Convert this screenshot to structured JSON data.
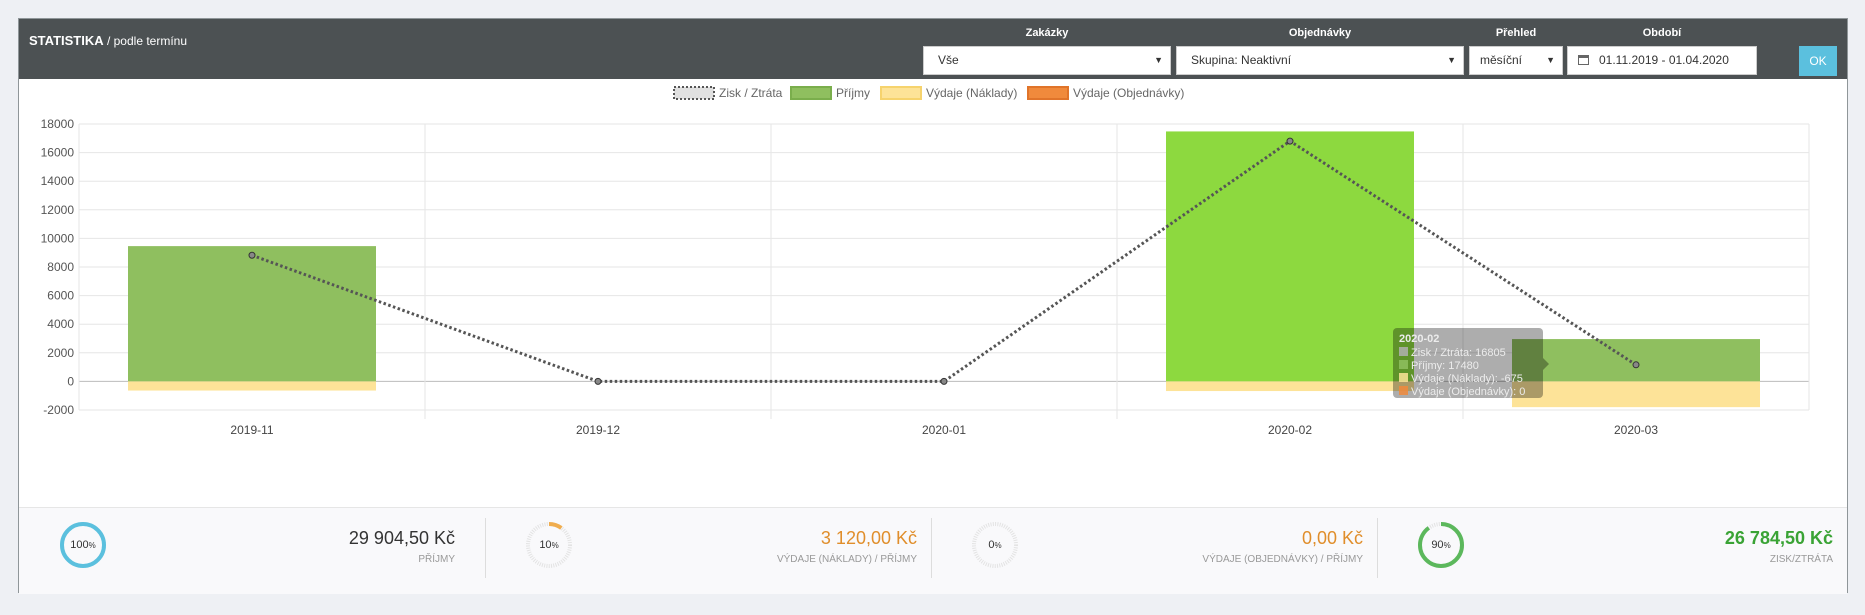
{
  "header": {
    "title_bold": "STATISTIKA",
    "title_rest": " / podle termínu"
  },
  "filters": {
    "zakazky": {
      "label": "Zakázky",
      "value": "Vše"
    },
    "objednavky": {
      "label": "Objednávky",
      "value": "Skupina: Neaktivní"
    },
    "prehled": {
      "label": "Přehled",
      "value": "měsíční"
    },
    "obdobi": {
      "label": "Období",
      "value": "01.11.2019 - 01.04.2020"
    },
    "ok_label": "OK"
  },
  "legend": [
    "Zisk / Ztráta",
    "Příjmy",
    "Výdaje (Náklady)",
    "Výdaje (Objednávky)"
  ],
  "tooltip": {
    "title": "2020-02",
    "lines": [
      "Zisk / Ztráta: 16805",
      "Příjmy: 17480",
      "Výdaje (Náklady): -675",
      "Výdaje (Objednávky): 0"
    ]
  },
  "chart_data": {
    "type": "bar",
    "categories": [
      "2019-11",
      "2019-12",
      "2020-01",
      "2020-02",
      "2020-03"
    ],
    "series": [
      {
        "name": "Příjmy",
        "type": "bar",
        "values": [
          9460,
          0,
          0,
          17480,
          2960
        ]
      },
      {
        "name": "Výdaje (Náklady)",
        "type": "bar",
        "values": [
          -640,
          0,
          0,
          -675,
          -1800
        ]
      },
      {
        "name": "Výdaje (Objednávky)",
        "type": "bar",
        "values": [
          0,
          0,
          0,
          0,
          0
        ]
      },
      {
        "name": "Zisk / Ztráta",
        "type": "line",
        "values": [
          8820,
          0,
          0,
          16805,
          1160
        ]
      }
    ],
    "ylim": [
      -2000,
      18000
    ],
    "yticks": [
      18000,
      16000,
      14000,
      12000,
      10000,
      8000,
      6000,
      4000,
      2000,
      0,
      -2000
    ],
    "legend_position": "top",
    "grid": true
  },
  "kpis": [
    {
      "percent": 100,
      "value": "29 904,50 Kč",
      "caption": "PŘÍJMY",
      "color": "#5bc0de",
      "text_color": "#333333"
    },
    {
      "percent": 10,
      "value": "3 120,00 Kč",
      "caption": "VÝDAJE (NÁKLADY) / PŘÍJMY",
      "color": "#f0ad4e",
      "text_color": "#e08e2b"
    },
    {
      "percent": 0,
      "value": "0,00 Kč",
      "caption": "VÝDAJE (OBJEDNÁVKY) / PŘÍJMY",
      "color": "#f0ad4e",
      "text_color": "#e08e2b"
    },
    {
      "percent": 90,
      "value": "26 784,50 Kč",
      "caption": "ZISK/ZTRÁTA",
      "color": "#5cb85c",
      "text_color": "#3aa335"
    }
  ],
  "colors": {
    "prijmy": "#8fbf5f",
    "prijmy_hover": "#8dd93f",
    "naklady": "#fde398",
    "objednavky": "#f08a3c",
    "line": "#555555"
  }
}
